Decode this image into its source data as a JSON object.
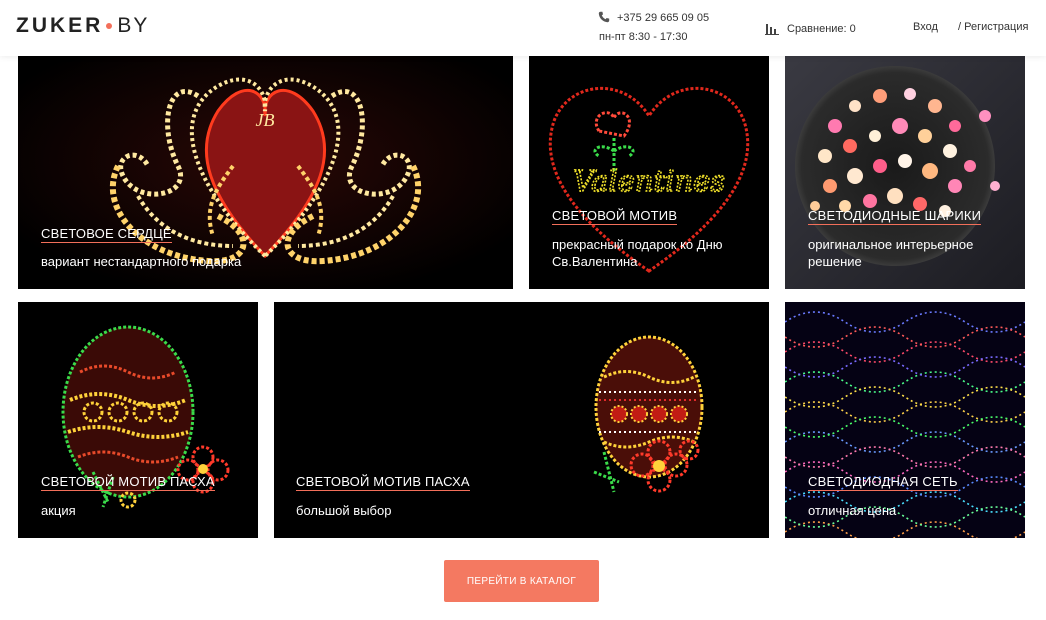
{
  "header": {
    "logo_main": "ZUKER",
    "logo_tld": "BY",
    "phone": "+375 29 665 09 05",
    "hours": "пн-пт 8:30 - 17:30",
    "compare_label": "Сравнение:",
    "compare_count": "0",
    "login": "Вход",
    "register": "/ Регистрация",
    "icons": {
      "phone": "phone-icon",
      "compare": "bar-chart-icon"
    }
  },
  "tiles": [
    {
      "title": "СВЕТОВОЕ СЕРДЦЕ",
      "desc": "вариант нестандартного подарка"
    },
    {
      "title": "СВЕТОВОЙ МОТИВ",
      "desc": "прекрасный подарок ко Дню Св.Валентина"
    },
    {
      "title": "СВЕТОДИОДНЫЕ ШАРИКИ",
      "desc": "оригинальное интерьерное решение"
    },
    {
      "title": "СВЕТОВОЙ МОТИВ ПАСХА",
      "desc": "акция"
    },
    {
      "title": "СВЕТОВОЙ МОТИВ ПАСХА",
      "desc": "большой выбор"
    },
    {
      "title": "СВЕТОДИОДНАЯ СЕТЬ",
      "desc": "отличная цена"
    }
  ],
  "tile_images": {
    "t0": "Valentines",
    "t1": "JB"
  },
  "cta": {
    "label": "ПЕРЕЙТИ В КАТАЛОГ"
  },
  "colors": {
    "accent": "#f47961",
    "underline": "#f36f5a"
  }
}
